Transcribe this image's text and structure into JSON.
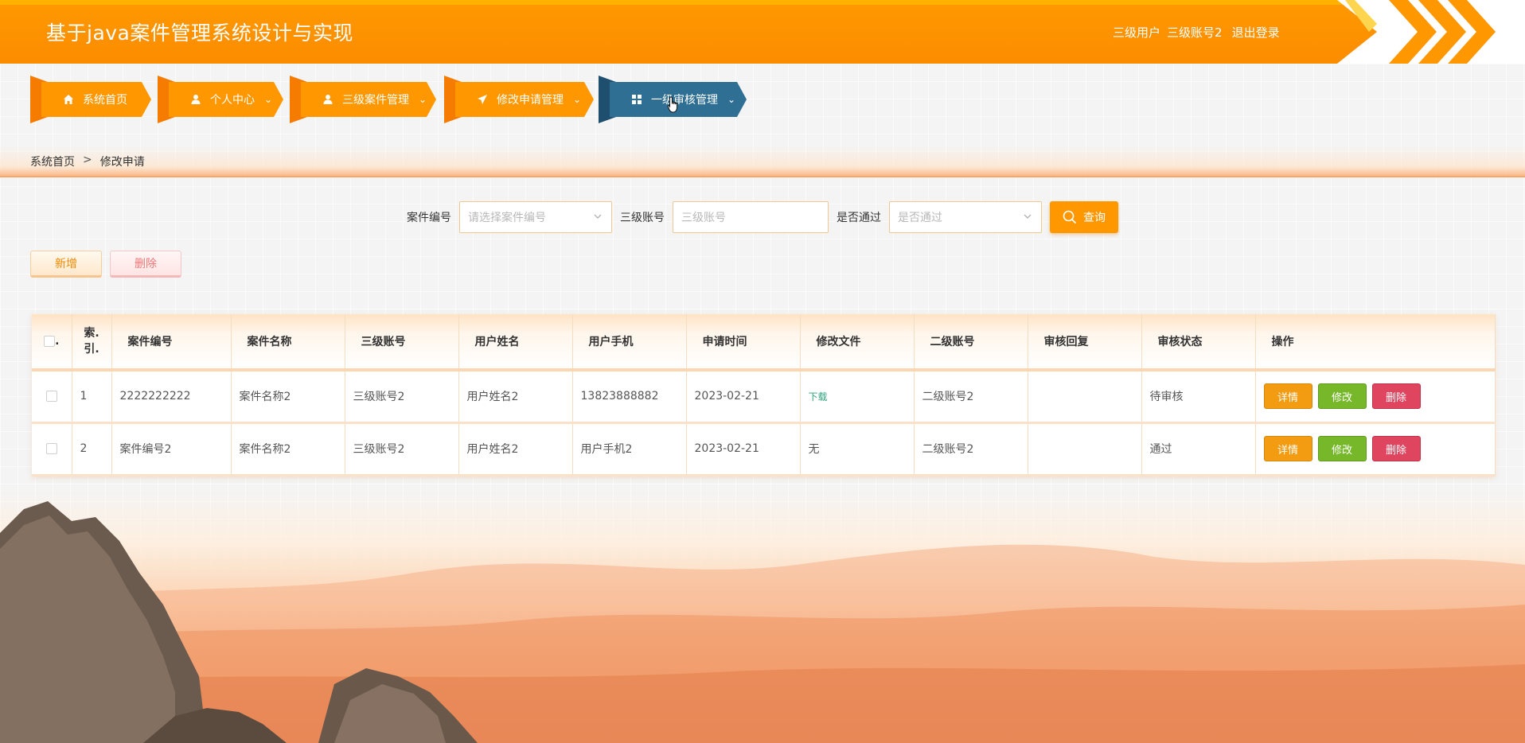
{
  "header": {
    "title": "基于java案件管理系统设计与实现",
    "user_role": "三级用户",
    "user_name": "三级账号2",
    "logout": "退出登录"
  },
  "nav": {
    "items": [
      {
        "label": "系统首页",
        "icon": "home-icon"
      },
      {
        "label": "个人中心",
        "icon": "user-icon"
      },
      {
        "label": "三级案件管理",
        "icon": "user-icon"
      },
      {
        "label": "修改申请管理",
        "icon": "send-icon"
      },
      {
        "label": "一级审核管理",
        "icon": "grid-icon",
        "active": true
      }
    ]
  },
  "breadcrumb": {
    "home": "系统首页",
    "sep": ">",
    "current": "修改申请"
  },
  "search": {
    "case_no_label": "案件编号",
    "case_no_placeholder": "请选择案件编号",
    "account_label": "三级账号",
    "account_placeholder": "三级账号",
    "passed_label": "是否通过",
    "passed_placeholder": "是否通过",
    "query_label": "查询"
  },
  "actions": {
    "add": "新增",
    "delete": "删除"
  },
  "table": {
    "headers": {
      "index_line1": "索.",
      "index_line2": "引.",
      "case_no": "案件编号",
      "case_name": "案件名称",
      "level3_account": "三级账号",
      "user_name": "用户姓名",
      "user_phone": "用户手机",
      "apply_time": "申请时间",
      "modify_file": "修改文件",
      "level2_account": "二级账号",
      "review_reply": "审核回复",
      "review_status": "审核状态",
      "operation": "操作"
    },
    "rows": [
      {
        "index": "1",
        "case_no": "2222222222",
        "case_name": "案件名称2",
        "level3_account": "三级账号2",
        "user_name": "用户姓名2",
        "user_phone": "13823888882",
        "apply_time": "2023-02-21",
        "modify_file": "下载",
        "level2_account": "二级账号2",
        "review_reply": "",
        "review_status": "待审核"
      },
      {
        "index": "2",
        "case_no": "案件编号2",
        "case_name": "案件名称2",
        "level3_account": "三级账号2",
        "user_name": "用户姓名2",
        "user_phone": "用户手机2",
        "apply_time": "2023-02-21",
        "modify_file": "无",
        "level2_account": "二级账号2",
        "review_reply": "",
        "review_status": "通过"
      }
    ],
    "row_buttons": {
      "detail": "详情",
      "edit": "修改",
      "remove": "删除"
    }
  },
  "colors": {
    "primary": "#ff9800",
    "active_nav": "#2f6f93",
    "detail": "#f39c12",
    "edit": "#76b82a",
    "remove": "#e04560"
  }
}
